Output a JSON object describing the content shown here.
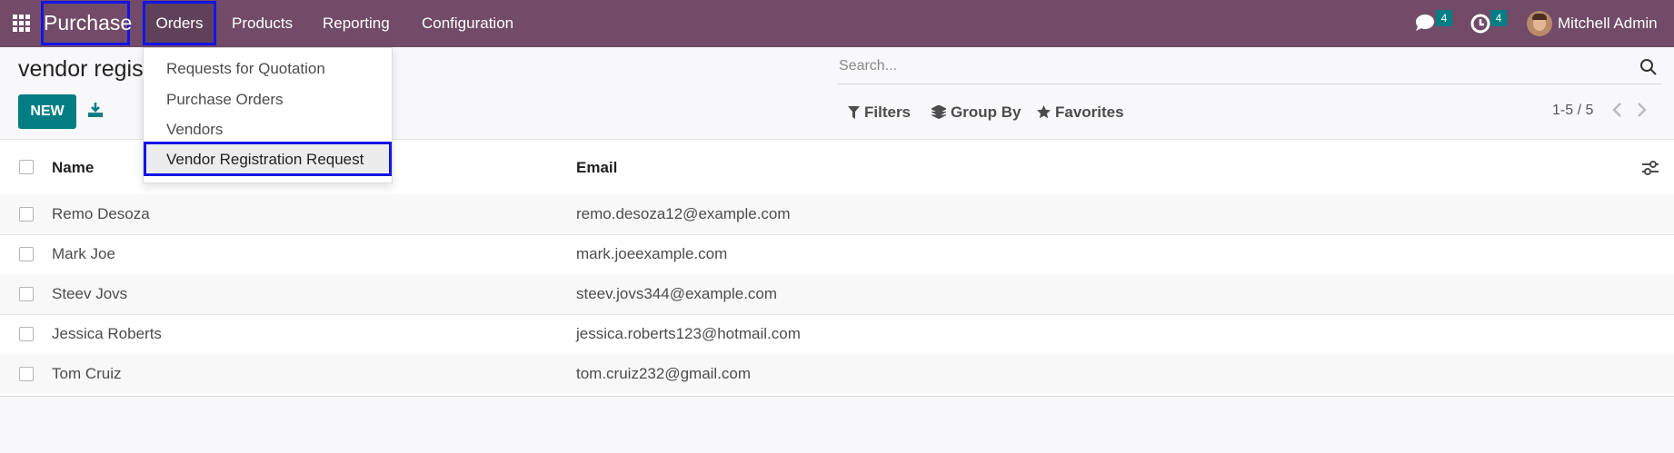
{
  "navbar": {
    "app_name": "Purchase",
    "menus": [
      "Orders",
      "Products",
      "Reporting",
      "Configuration"
    ],
    "messages_count": "4",
    "activities_count": "4",
    "user_name": "Mitchell Admin",
    "bg_color": "#714b67"
  },
  "orders_dropdown": {
    "items": [
      "Requests for Quotation",
      "Purchase Orders",
      "Vendors",
      "Vendor Registration Request"
    ]
  },
  "page": {
    "title": "vendor regist",
    "new_button": "NEW"
  },
  "search": {
    "placeholder": "Search..."
  },
  "filters": {
    "filters_label": "Filters",
    "group_by_label": "Group By",
    "favorites_label": "Favorites"
  },
  "pager": {
    "value": "1-5 / 5"
  },
  "list": {
    "columns": [
      "Name",
      "Email"
    ],
    "rows": [
      {
        "name": "Remo Desoza",
        "email": "remo.desoza12@example.com"
      },
      {
        "name": "Mark Joe",
        "email": "mark.joeexample.com"
      },
      {
        "name": "Steev Jovs",
        "email": "steev.jovs344@example.com"
      },
      {
        "name": "Jessica Roberts",
        "email": "jessica.roberts123@hotmail.com"
      },
      {
        "name": "Tom Cruiz",
        "email": "tom.cruiz232@gmail.com"
      }
    ]
  },
  "colors": {
    "accent": "#017e84",
    "highlight_border": "#1414e6"
  }
}
